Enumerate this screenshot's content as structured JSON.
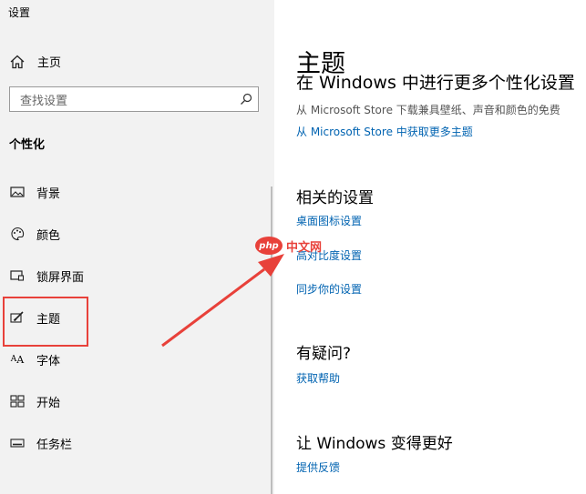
{
  "window": {
    "title": "设置"
  },
  "sidebar": {
    "home_label": "主页",
    "search_placeholder": "查找设置",
    "section_label": "个性化",
    "items": [
      {
        "label": "背景",
        "icon": "picture-icon"
      },
      {
        "label": "颜色",
        "icon": "palette-icon"
      },
      {
        "label": "锁屏界面",
        "icon": "lock-screen-icon"
      },
      {
        "label": "主题",
        "icon": "theme-brush-icon"
      },
      {
        "label": "字体",
        "icon": "font-icon"
      },
      {
        "label": "开始",
        "icon": "start-grid-icon"
      },
      {
        "label": "任务栏",
        "icon": "taskbar-icon"
      }
    ]
  },
  "main": {
    "title": "主题",
    "store_heading": "在 Windows 中进行更多个性化设置",
    "store_desc": "从 Microsoft Store 下载兼具壁纸、声音和颜色的免费",
    "store_link": "从 Microsoft Store 中获取更多主题",
    "related_heading": "相关的设置",
    "related_links": [
      "桌面图标设置",
      "高对比度设置",
      "同步你的设置"
    ],
    "question_heading": "有疑问?",
    "help_link": "获取帮助",
    "feedback_heading": "让 Windows 变得更好",
    "feedback_link": "提供反馈"
  },
  "watermark": {
    "badge": "php",
    "text": "中文网"
  },
  "colors": {
    "accent_link": "#0063b1",
    "annotation_red": "#e8413a",
    "sidebar_bg": "#f2f2f2"
  }
}
